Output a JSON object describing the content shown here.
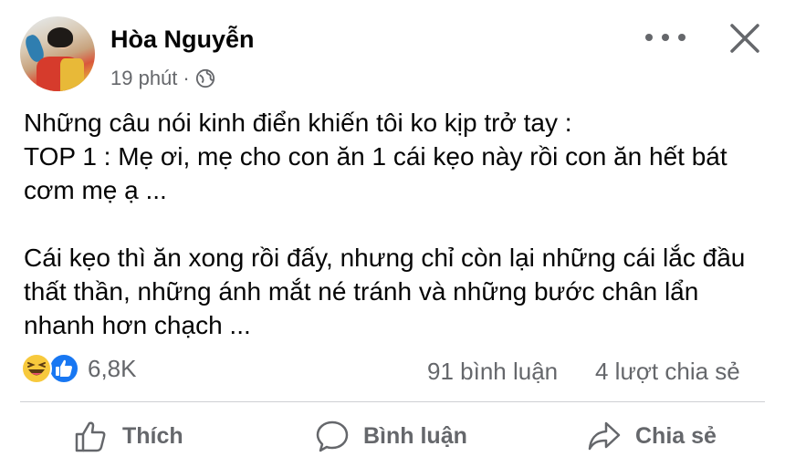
{
  "post": {
    "author": "Hòa Nguyễn",
    "time": "19 phút",
    "separator": "·",
    "body": "Những câu nói kinh điển khiến tôi ko kịp trở tay :\nTOP 1 : Mẹ ơi, mẹ cho con ăn 1 cái kẹo này rồi con ăn hết bát cơm mẹ ạ ...\n\nCái kẹo thì ăn xong rồi đấy, nhưng chỉ còn lại những cái lắc đầu thất thần, những ánh mắt né tránh và những bước chân lẩn nhanh hơn chạch ..."
  },
  "stats": {
    "reactions": "6,8K",
    "comments": "91 bình luận",
    "shares": "4 lượt chia sẻ"
  },
  "actions": {
    "like": "Thích",
    "comment": "Bình luận",
    "share": "Chia sẻ"
  },
  "icons": {
    "privacy": "globe-icon",
    "reactions": [
      "haha-reaction-icon",
      "like-reaction-icon"
    ]
  },
  "colors": {
    "secondary_text": "#65676b",
    "like_blue": "#1877f2",
    "haha_yellow": "#f7c93c"
  }
}
